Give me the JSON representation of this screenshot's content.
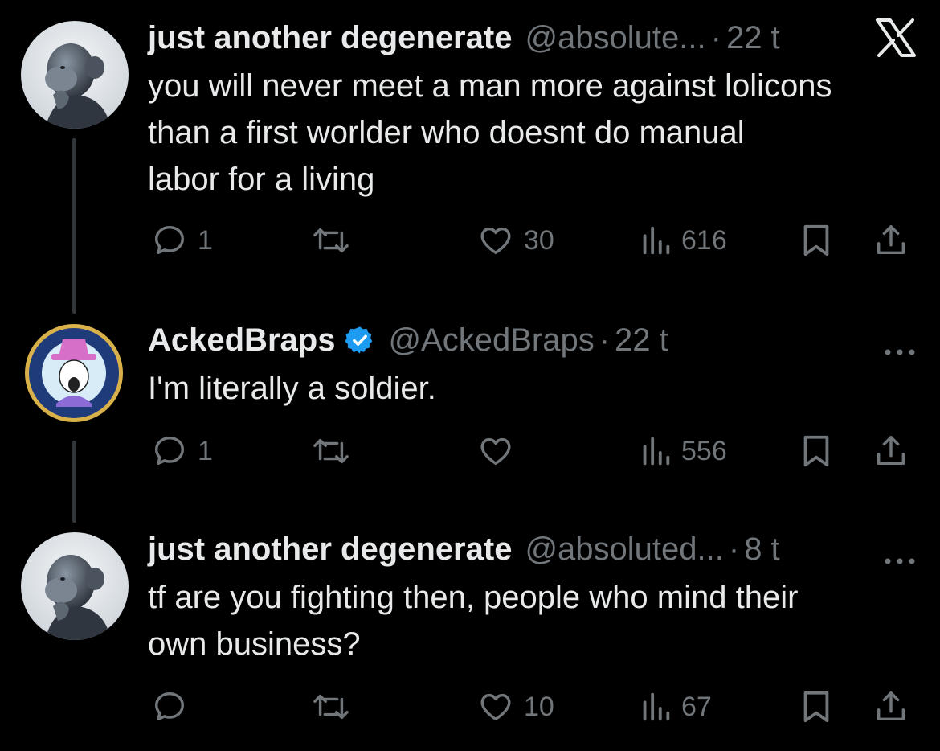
{
  "tweets": [
    {
      "name": "just another degenerate",
      "handle": "@absolute...",
      "dot": "·",
      "time": "22 t",
      "verified": false,
      "text_lines": [
        "you will never meet a man more against lolicons",
        "than a first worlder who doesnt do manual",
        "labor for a living"
      ],
      "replies": "1",
      "retweets": "",
      "likes": "30",
      "views": "616",
      "corner_icon": "x-logo-icon"
    },
    {
      "name": "AckedBraps",
      "handle": "@AckedBraps",
      "dot": "·",
      "time": "22 t",
      "verified": true,
      "text_lines": [
        "I'm literally a soldier."
      ],
      "replies": "1",
      "retweets": "",
      "likes": "",
      "views": "556",
      "corner_icon": "more-icon"
    },
    {
      "name": "just another degenerate",
      "handle": "@absoluted...",
      "dot": "·",
      "time": "8 t",
      "verified": false,
      "text_lines": [
        "tf are you fighting then, people who mind their",
        "own business?"
      ],
      "replies": "",
      "retweets": "",
      "likes": "10",
      "views": "67",
      "corner_icon": "more-icon"
    }
  ],
  "colors": {
    "background": "#000000",
    "text_primary": "#e7e9ea",
    "text_secondary": "#71767b",
    "thread_line": "#333639",
    "verified_badge": "#1d9bf0"
  }
}
